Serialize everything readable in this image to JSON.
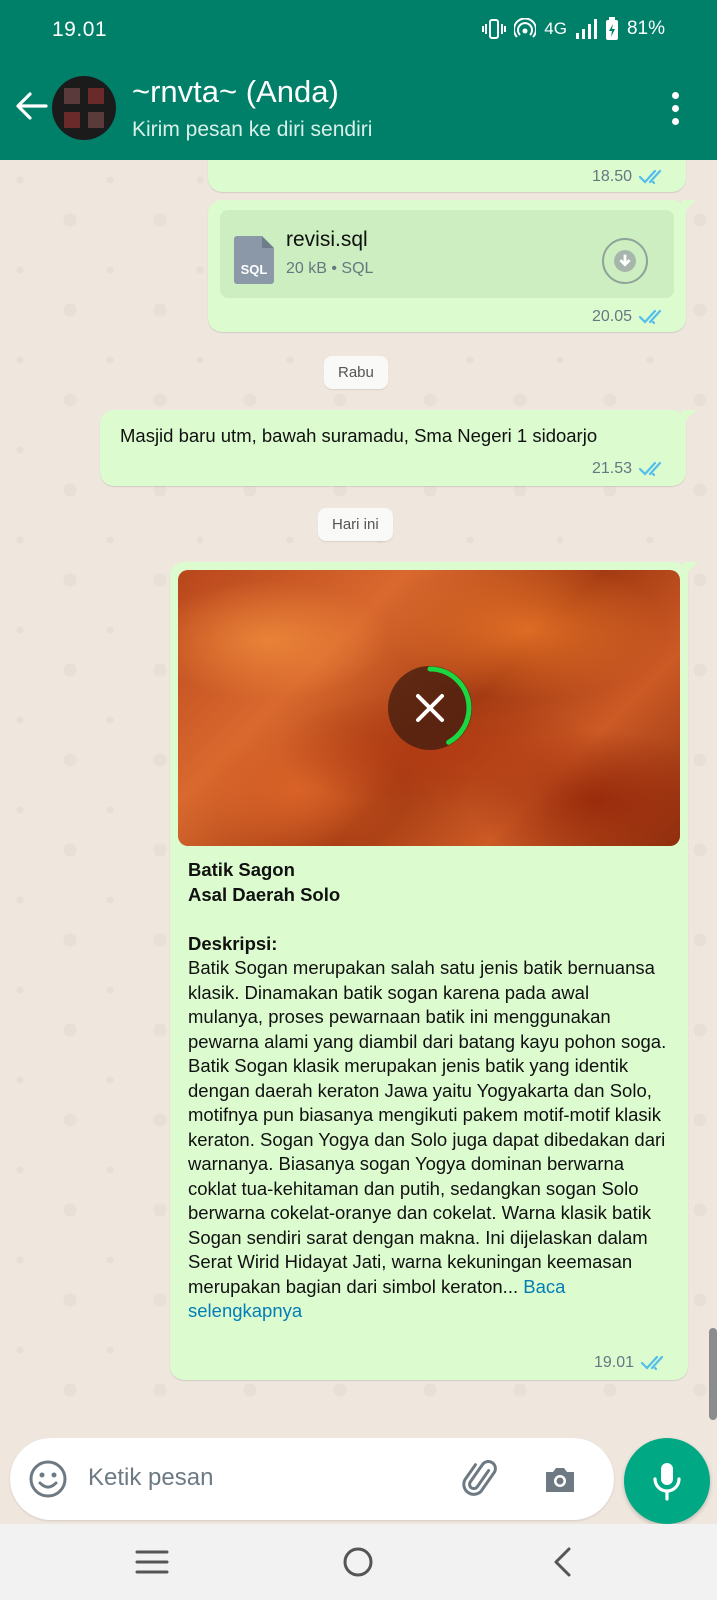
{
  "status_bar": {
    "time": "19.01",
    "network": "4G",
    "battery": "81%"
  },
  "header": {
    "title": "~rnvta~ (Anda)",
    "subtitle": "Kirim pesan ke diri sendiri"
  },
  "messages": {
    "partial": {
      "time": "18.50"
    },
    "document": {
      "file_name": "revisi.sql",
      "file_info": "20 kB • SQL",
      "badge": "SQL",
      "time": "20.05"
    },
    "day_rabu": "Rabu",
    "text_msg": {
      "text": "Masjid baru utm, bawah suramadu, Sma Negeri 1 sidoarjo",
      "time": "21.53"
    },
    "day_today": "Hari ini",
    "image_msg": {
      "title_line1": "Batik Sagon",
      "title_line2": "Asal Daerah Solo",
      "desc_label": "Deskripsi:",
      "description": "Batik Sogan merupakan salah satu jenis batik bernuansa klasik. Dinamakan batik sogan karena pada awal mulanya, proses pewarnaan batik ini menggunakan pewarna alami yang diambil dari batang kayu pohon soga. Batik Sogan klasik merupakan jenis batik yang identik dengan daerah keraton Jawa yaitu Yogyakarta dan Solo, motifnya pun biasanya mengikuti pakem motif-motif klasik keraton. Sogan Yogya dan Solo juga dapat dibedakan dari warnanya. Biasanya sogan Yogya dominan berwarna coklat tua-kehitaman dan putih, sedangkan sogan Solo berwarna cokelat-oranye dan cokelat. Warna klasik batik Sogan sendiri sarat dengan makna. Ini dijelaskan dalam Serat Wirid Hidayat Jati, warna kekuningan keemasan merupakan bagian dari simbol keraton...",
      "read_more": "Baca selengkapnya",
      "time": "19.01",
      "upload_progress": 0.42
    }
  },
  "input": {
    "placeholder": "Ketik pesan"
  },
  "colors": {
    "primary": "#008069",
    "bubble": "#dcfcd0",
    "accent": "#00a884",
    "tick": "#53bdeb"
  }
}
